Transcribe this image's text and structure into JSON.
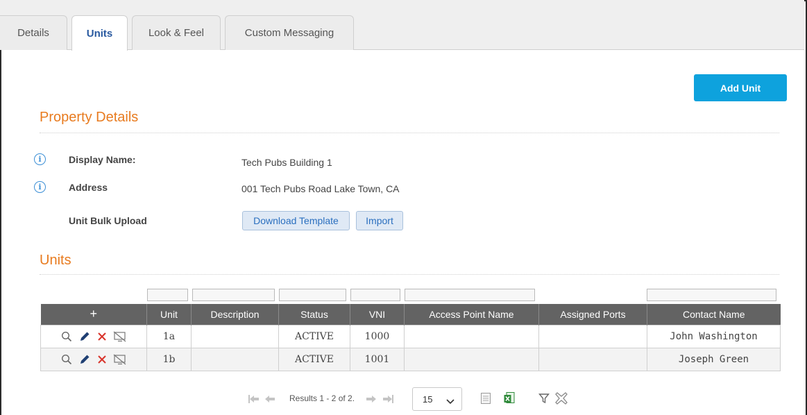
{
  "tabs": [
    {
      "label": "Details"
    },
    {
      "label": "Units"
    },
    {
      "label": "Look & Feel"
    },
    {
      "label": "Custom Messaging"
    }
  ],
  "add_unit_label": "Add Unit",
  "property_details": {
    "title": "Property Details",
    "display_name_label": "Display Name:",
    "display_name_value": "Tech Pubs Building 1",
    "address_label": "Address",
    "address_value": "001 Tech Pubs Road Lake Town, CA",
    "bulk_upload_label": "Unit Bulk Upload",
    "download_template_label": "Download Template",
    "import_label": "Import"
  },
  "units": {
    "title": "Units",
    "add_symbol": "+",
    "columns": [
      "Unit",
      "Description",
      "Status",
      "VNI",
      "Access Point Name",
      "Assigned Ports",
      "Contact Name"
    ],
    "rows": [
      {
        "unit": "1a",
        "description": "",
        "status": "ACTIVE",
        "vni": "1000",
        "ap_name": "",
        "ports": "",
        "contact": "John Washington"
      },
      {
        "unit": "1b",
        "description": "",
        "status": "ACTIVE",
        "vni": "1001",
        "ap_name": "",
        "ports": "",
        "contact": "Joseph Green"
      }
    ]
  },
  "pager": {
    "results_text": "Results 1 - 2 of 2.",
    "page_size": "15"
  },
  "colors": {
    "accent_orange": "#e87b1f",
    "primary_button": "#0ea2dd",
    "header_gray": "#636363",
    "delete_red": "#d9342b",
    "edit_navy": "#1f3f73"
  },
  "icons": [
    "search-icon",
    "edit-icon",
    "delete-icon",
    "no-display-icon",
    "info-icon",
    "first-page-icon",
    "prev-page-icon",
    "next-page-icon",
    "last-page-icon",
    "chevron-down-icon",
    "export-pdf-icon",
    "export-excel-icon",
    "filter-icon",
    "clear-filter-icon"
  ]
}
